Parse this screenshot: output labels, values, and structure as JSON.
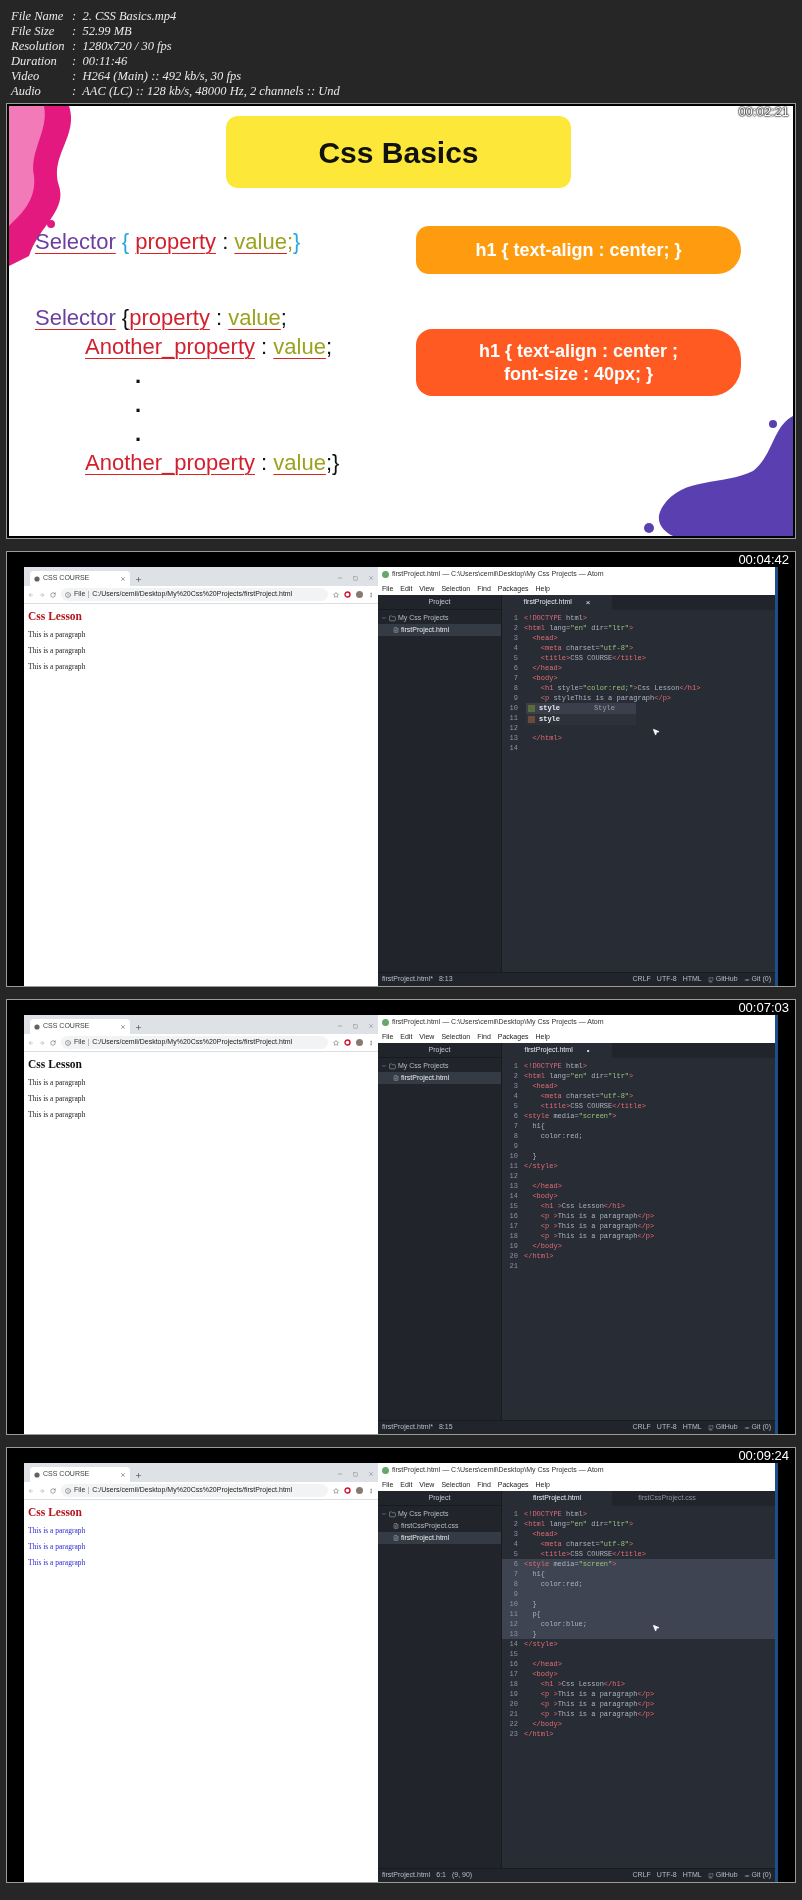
{
  "info": [
    {
      "label": "File Name",
      "value": ":  2. CSS Basics.mp4"
    },
    {
      "label": "File Size",
      "value": ":  52.99 MB"
    },
    {
      "label": "Resolution",
      "value": ":  1280x720 / 30 fps"
    },
    {
      "label": "Duration",
      "value": ":  00:11:46"
    },
    {
      "label": "Video",
      "value": ":  H264 (Main) :: 492 kb/s, 30 fps"
    },
    {
      "label": "Audio",
      "value": ":  AAC (LC) :: 128 kb/s, 48000 Hz, 2 channels :: Und"
    }
  ],
  "frames": [
    {
      "kind": "slide",
      "timestamp": "00:02:21",
      "slide": {
        "title": "Css Basics",
        "syntax_blocks": [
          {
            "lines": [
              {
                "kind": "main",
                "tokens": [
                  {
                    "text": "Selector",
                    "kind": "selector"
                  },
                  {
                    "text": " { ",
                    "kind": "brace"
                  },
                  {
                    "text": "property",
                    "kind": "property"
                  },
                  {
                    "text": " : ",
                    "kind": "plain"
                  },
                  {
                    "text": "value",
                    "kind": "value"
                  },
                  {
                    "text": ";",
                    "kind": "valuemark"
                  },
                  {
                    "text": "}",
                    "kind": "brace"
                  }
                ]
              }
            ]
          },
          {
            "lines": [
              {
                "kind": "main",
                "tokens": [
                  {
                    "text": "Selector",
                    "kind": "selector"
                  },
                  {
                    "text": " {",
                    "kind": "plain"
                  },
                  {
                    "text": "property",
                    "kind": "property"
                  },
                  {
                    "text": " : ",
                    "kind": "plain"
                  },
                  {
                    "text": "value",
                    "kind": "value"
                  },
                  {
                    "text": ";",
                    "kind": "plain"
                  }
                ]
              },
              {
                "kind": "nested",
                "tokens": [
                  {
                    "text": "Another_property",
                    "kind": "property"
                  },
                  {
                    "text": " : ",
                    "kind": "plain"
                  },
                  {
                    "text": "value",
                    "kind": "value"
                  },
                  {
                    "text": ";",
                    "kind": "plain"
                  }
                ]
              },
              {
                "kind": "dot",
                "tokens": [
                  {
                    "text": ".",
                    "kind": "plain"
                  }
                ]
              },
              {
                "kind": "dot",
                "tokens": [
                  {
                    "text": ".",
                    "kind": "plain"
                  }
                ]
              },
              {
                "kind": "dot",
                "tokens": [
                  {
                    "text": ".",
                    "kind": "plain"
                  }
                ]
              },
              {
                "kind": "nested",
                "tokens": [
                  {
                    "text": "Another_property",
                    "kind": "property"
                  },
                  {
                    "text": " : ",
                    "kind": "plain"
                  },
                  {
                    "text": "value",
                    "kind": "value"
                  },
                  {
                    "text": ";}",
                    "kind": "plain"
                  }
                ]
              }
            ]
          }
        ],
        "examples": [
          {
            "lines": [
              "h1 { text-align : center; }"
            ],
            "color": "#ff9b0f"
          },
          {
            "lines": [
              "h1 { text-align : center ;",
              "font-size : 40px; }"
            ],
            "color": "#ff5a22"
          }
        ]
      }
    },
    {
      "kind": "screen",
      "timestamp": "00:04:42",
      "browser": {
        "tab_title": "CSS COURSE",
        "address_prefix": "File",
        "url": "C:/Users/cemil/Desktop/My%20Css%20Projects/firstProject.html",
        "heading": {
          "text": "Css Lesson",
          "color": "#b5151c"
        },
        "paragraphs": [
          {
            "text": "This is a paragraph",
            "kind": "default"
          },
          {
            "text": "This is a paragraph",
            "kind": "default"
          },
          {
            "text": "This is a paragraph",
            "kind": "default"
          }
        ]
      },
      "editor": {
        "title": "firstProject.html — C:\\Users\\cemil\\Desktop\\My Css Projects — Atom",
        "menu": [
          "File",
          "Edit",
          "View",
          "Selection",
          "Find",
          "Packages",
          "Help"
        ],
        "tree_header": "Project",
        "folder": "My Css Projects",
        "files": [
          {
            "name": "firstProject.html",
            "selected": true
          }
        ],
        "tabs": [
          {
            "label": "firstProject.html",
            "marker": "×",
            "selected": true
          }
        ],
        "lines": [
          {
            "n": "1",
            "code": "<!DOCTYPE html>",
            "selected": false
          },
          {
            "n": "2",
            "code": "<html lang=\"en\" dir=\"ltr\">",
            "selected": false
          },
          {
            "n": "3",
            "code": "  <head>",
            "selected": false
          },
          {
            "n": "4",
            "code": "    <meta charset=\"utf-8\">",
            "selected": false
          },
          {
            "n": "5",
            "code": "    <title>CSS COURSE</title>",
            "selected": false
          },
          {
            "n": "6",
            "code": "  </head>",
            "selected": false
          },
          {
            "n": "7",
            "code": "  <body>",
            "selected": false
          },
          {
            "n": "8",
            "code": "    <h1 style=\"color:red;\">Css Lesson</h1>",
            "selected": false
          },
          {
            "n": "9",
            "code": "    <p styleThis is a paragraph</p>",
            "selected": false
          },
          {
            "n": "10",
            "selected": false
          },
          {
            "n": "11",
            "selected": false
          },
          {
            "n": "12",
            "selected": false
          },
          {
            "n": "13",
            "code": "  </html>",
            "selected": false
          },
          {
            "n": "14",
            "selected": false
          }
        ],
        "autocomplete": [
          {
            "text": "style",
            "hint": "Style",
            "selected": true
          },
          {
            "text": "style",
            "selected": false
          }
        ],
        "mouse_cursor": true,
        "status_left": [
          "firstProject.html*",
          "8:13"
        ],
        "status_right": [
          {
            "text": "CRLF",
            "kind": "plain"
          },
          {
            "text": "UTF-8",
            "kind": "plain"
          },
          {
            "text": "HTML",
            "kind": "plain"
          },
          {
            "text": "GitHub",
            "kind": "github"
          },
          {
            "text": "Git (0)",
            "kind": "git"
          }
        ]
      }
    },
    {
      "kind": "screen",
      "timestamp": "00:07:03",
      "browser": {
        "tab_title": "CSS COURSE",
        "address_prefix": "File",
        "url": "C:/Users/cemil/Desktop/My%20Css%20Projects/firstProject.html",
        "heading": {
          "text": "Css Lesson",
          "color": "#111111"
        },
        "paragraphs": [
          {
            "text": "This is a paragraph",
            "kind": "default"
          },
          {
            "text": "This is a paragraph",
            "kind": "default"
          },
          {
            "text": "This is a paragraph",
            "kind": "default"
          }
        ]
      },
      "editor": {
        "title": "firstProject.html — C:\\Users\\cemil\\Desktop\\My Css Projects — Atom",
        "menu": [
          "File",
          "Edit",
          "View",
          "Selection",
          "Find",
          "Packages",
          "Help"
        ],
        "tree_header": "Project",
        "folder": "My Css Projects",
        "files": [
          {
            "name": "firstProject.html",
            "selected": true
          }
        ],
        "tabs": [
          {
            "label": "firstProject.html",
            "marker": "•",
            "selected": true
          }
        ],
        "lines": [
          {
            "n": "1",
            "code": "<!DOCTYPE html>",
            "selected": false
          },
          {
            "n": "2",
            "code": "<html lang=\"en\" dir=\"ltr\">",
            "selected": false
          },
          {
            "n": "3",
            "code": "  <head>",
            "selected": false
          },
          {
            "n": "4",
            "code": "    <meta charset=\"utf-8\">",
            "selected": false
          },
          {
            "n": "5",
            "code": "    <title>CSS COURSE</title>",
            "selected": false
          },
          {
            "n": "6",
            "code": "<style media=\"screen\">",
            "selected": false
          },
          {
            "n": "7",
            "code": "  h1{",
            "selected": false
          },
          {
            "n": "8",
            "code": "    color:red;",
            "selected": false
          },
          {
            "n": "9",
            "selected": false
          },
          {
            "n": "10",
            "code": "  }",
            "selected": false
          },
          {
            "n": "11",
            "code": "</style>",
            "selected": false
          },
          {
            "n": "12",
            "selected": false
          },
          {
            "n": "13",
            "code": "  </head>",
            "selected": false
          },
          {
            "n": "14",
            "code": "  <body>",
            "selected": false
          },
          {
            "n": "15",
            "code": "    <h1 >Css Lesson</h1>",
            "selected": false
          },
          {
            "n": "16",
            "code": "    <p >This is a paragraph</p>",
            "selected": false
          },
          {
            "n": "17",
            "code": "    <p >This is a paragraph</p>",
            "selected": false
          },
          {
            "n": "18",
            "code": "    <p >This is a paragraph</p>",
            "selected": false
          },
          {
            "n": "19",
            "code": "  </body>",
            "selected": false
          },
          {
            "n": "20",
            "code": "</html>",
            "selected": false
          },
          {
            "n": "21",
            "selected": false
          }
        ],
        "mouse_cursor": false,
        "status_left": [
          "firstProject.html*",
          "8:15"
        ],
        "status_right": [
          {
            "text": "CRLF",
            "kind": "plain"
          },
          {
            "text": "UTF-8",
            "kind": "plain"
          },
          {
            "text": "HTML",
            "kind": "plain"
          },
          {
            "text": "GitHub",
            "kind": "github"
          },
          {
            "text": "Git (0)",
            "kind": "git"
          }
        ]
      }
    },
    {
      "kind": "screen",
      "timestamp": "00:09:24",
      "browser": {
        "tab_title": "CSS COURSE",
        "address_prefix": "File",
        "url": "C:/Users/cemil/Desktop/My%20Css%20Projects/firstProject.html",
        "heading": {
          "text": "Css Lesson",
          "color": "#b5151c"
        },
        "paragraphs": [
          {
            "text": "This is a paragraph",
            "kind": "styled"
          },
          {
            "text": "This is a paragraph",
            "kind": "styled"
          },
          {
            "text": "This is a paragraph",
            "kind": "styled"
          }
        ]
      },
      "editor": {
        "title": "firstProject.html — C:\\Users\\cemil\\Desktop\\My Css Projects — Atom",
        "menu": [
          "File",
          "Edit",
          "View",
          "Selection",
          "Find",
          "Packages",
          "Help"
        ],
        "tree_header": "Project",
        "folder": "My Css Projects",
        "files": [
          {
            "name": "firstCssProject.css",
            "selected": false
          },
          {
            "name": "firstProject.html",
            "selected": true
          }
        ],
        "tabs": [
          {
            "label": "firstProject.html",
            "selected": true
          },
          {
            "label": "firstCssProject.css",
            "selected": false
          }
        ],
        "lines": [
          {
            "n": "1",
            "code": "<!DOCTYPE html>",
            "selected": false
          },
          {
            "n": "2",
            "code": "<html lang=\"en\" dir=\"ltr\">",
            "selected": false
          },
          {
            "n": "3",
            "code": "  <head>",
            "selected": false
          },
          {
            "n": "4",
            "code": "    <meta charset=\"utf-8\">",
            "selected": false
          },
          {
            "n": "5",
            "code": "    <title>CSS COURSE</title>",
            "selected": false
          },
          {
            "n": "6",
            "code": "<style media=\"screen\">",
            "selected": true
          },
          {
            "n": "7",
            "code": "  h1{",
            "selected": true
          },
          {
            "n": "8",
            "code": "    color:red;",
            "selected": true
          },
          {
            "n": "9",
            "selected": true
          },
          {
            "n": "10",
            "code": "  }",
            "selected": true
          },
          {
            "n": "11",
            "code": "  p{",
            "selected": true
          },
          {
            "n": "12",
            "code": "    color:blue;",
            "selected": true
          },
          {
            "n": "13",
            "code": "  }",
            "selected": true
          },
          {
            "n": "14",
            "code": "</style>",
            "selected": false
          },
          {
            "n": "15",
            "selected": false
          },
          {
            "n": "16",
            "code": "  </head>",
            "selected": false
          },
          {
            "n": "17",
            "code": "  <body>",
            "selected": false
          },
          {
            "n": "18",
            "code": "    <h1 >Css Lesson</h1>",
            "selected": false
          },
          {
            "n": "19",
            "code": "    <p >This is a paragraph</p>",
            "selected": false
          },
          {
            "n": "20",
            "code": "    <p >This is a paragraph</p>",
            "selected": false
          },
          {
            "n": "21",
            "code": "    <p >This is a paragraph</p>",
            "selected": false
          },
          {
            "n": "22",
            "code": "  </body>",
            "selected": false
          },
          {
            "n": "23",
            "code": "</html>",
            "selected": false
          }
        ],
        "mouse_cursor": true,
        "status_left": [
          "firstProject.html",
          "6:1",
          "(9, 90)"
        ],
        "status_right": [
          {
            "text": "CRLF",
            "kind": "plain"
          },
          {
            "text": "UTF-8",
            "kind": "plain"
          },
          {
            "text": "HTML",
            "kind": "plain"
          },
          {
            "text": "GitHub",
            "kind": "github"
          },
          {
            "text": "Git (0)",
            "kind": "git"
          }
        ]
      }
    }
  ]
}
